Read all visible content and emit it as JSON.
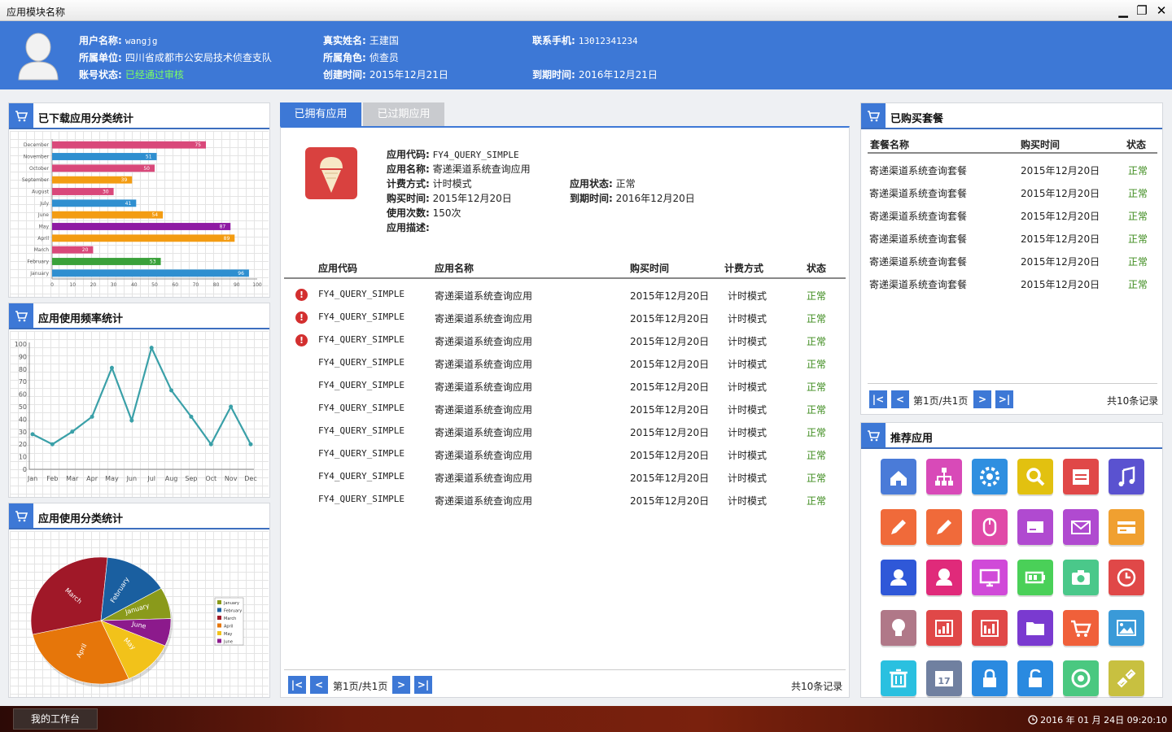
{
  "window": {
    "title": "应用模块名称",
    "min": "▁",
    "restore": "❐",
    "close": "✕"
  },
  "user": {
    "username_label": "用户名称:",
    "username": "wangjg",
    "unit_label": "所属单位:",
    "unit": "四川省成都市公安局技术侦查支队",
    "status_label": "账号状态:",
    "status": "已经通过审核",
    "realname_label": "真实姓名:",
    "realname": "王建国",
    "role_label": "所属角色:",
    "role": "侦查员",
    "created_label": "创建时间:",
    "created": "2015年12月21日",
    "phone_label": "联系手机:",
    "phone": "13012341234",
    "expire_label": "到期时间:",
    "expire": "2016年12月21日"
  },
  "panels": {
    "download_stats": "已下载应用分类统计",
    "freq_stats": "应用使用频率统计",
    "category_stats": "应用使用分类统计",
    "purchased": "已购买套餐",
    "recommended": "推荐应用"
  },
  "chart_data": [
    {
      "type": "bar",
      "categories": [
        "December",
        "November",
        "October",
        "September",
        "August",
        "July",
        "June",
        "May",
        "April",
        "March",
        "February",
        "January"
      ],
      "values": [
        75,
        51,
        50,
        39,
        30,
        41,
        54,
        87,
        89,
        20,
        53,
        96
      ],
      "colors": [
        "#d9487a",
        "#2f8fd0",
        "#d9487a",
        "#f39c12",
        "#d9487a",
        "#2f8fd0",
        "#f39c12",
        "#8e1aa3",
        "#f39c12",
        "#d9487a",
        "#3aa13a",
        "#2f8fd0"
      ],
      "xlim": [
        0,
        100
      ],
      "xticks": [
        0,
        10,
        20,
        30,
        40,
        50,
        60,
        70,
        80,
        90,
        100
      ]
    },
    {
      "type": "line",
      "categories": [
        "Jan",
        "Feb",
        "Mar",
        "Apr",
        "May",
        "Jun",
        "Jul",
        "Aug",
        "Sep",
        "Oct",
        "Nov",
        "Dec"
      ],
      "values": [
        28,
        20,
        30,
        42,
        81,
        39,
        97,
        63,
        42,
        20,
        50,
        20
      ],
      "ylim": [
        0,
        100
      ],
      "yticks": [
        0,
        10,
        20,
        30,
        40,
        50,
        60,
        70,
        80,
        90,
        100
      ],
      "color": "#3aa0a8"
    },
    {
      "type": "pie",
      "labels": [
        "January",
        "February",
        "March",
        "April",
        "May",
        "June"
      ],
      "values": [
        8,
        15,
        30,
        28,
        12,
        7
      ],
      "colors": [
        "#8a9a1b",
        "#1a5fa0",
        "#a01828",
        "#e6760a",
        "#f2c21a",
        "#8c1a8c"
      ]
    }
  ],
  "tabs": {
    "owned": "已拥有应用",
    "expired": "已过期应用"
  },
  "app_detail": {
    "code_label": "应用代码:",
    "code": "FY4_QUERY_SIMPLE",
    "name_label": "应用名称:",
    "name": "寄递渠道系统查询应用",
    "billing_label": "计费方式:",
    "billing": "计时模式",
    "state_label": "应用状态:",
    "state": "正常",
    "buy_label": "购买时间:",
    "buy": "2015年12月20日",
    "due_label": "到期时间:",
    "due": "2016年12月20日",
    "count_label": "使用次数:",
    "count": "150次",
    "desc_label": "应用描述:",
    "desc": ""
  },
  "table": {
    "headers": [
      "应用代码",
      "应用名称",
      "购买时间",
      "计费方式",
      "状态"
    ],
    "rows": [
      {
        "warn": "!",
        "code": "FY4_QUERY_SIMPLE",
        "name": "寄递渠道系统查询应用",
        "date": "2015年12月20日",
        "billing": "计时模式",
        "status": "正常"
      },
      {
        "warn": "!",
        "code": "FY4_QUERY_SIMPLE",
        "name": "寄递渠道系统查询应用",
        "date": "2015年12月20日",
        "billing": "计时模式",
        "status": "正常"
      },
      {
        "warn": "!",
        "code": "FY4_QUERY_SIMPLE",
        "name": "寄递渠道系统查询应用",
        "date": "2015年12月20日",
        "billing": "计时模式",
        "status": "正常"
      },
      {
        "warn": "",
        "code": "FY4_QUERY_SIMPLE",
        "name": "寄递渠道系统查询应用",
        "date": "2015年12月20日",
        "billing": "计时模式",
        "status": "正常"
      },
      {
        "warn": "",
        "code": "FY4_QUERY_SIMPLE",
        "name": "寄递渠道系统查询应用",
        "date": "2015年12月20日",
        "billing": "计时模式",
        "status": "正常"
      },
      {
        "warn": "",
        "code": "FY4_QUERY_SIMPLE",
        "name": "寄递渠道系统查询应用",
        "date": "2015年12月20日",
        "billing": "计时模式",
        "status": "正常"
      },
      {
        "warn": "",
        "code": "FY4_QUERY_SIMPLE",
        "name": "寄递渠道系统查询应用",
        "date": "2015年12月20日",
        "billing": "计时模式",
        "status": "正常"
      },
      {
        "warn": "",
        "code": "FY4_QUERY_SIMPLE",
        "name": "寄递渠道系统查询应用",
        "date": "2015年12月20日",
        "billing": "计时模式",
        "status": "正常"
      },
      {
        "warn": "",
        "code": "FY4_QUERY_SIMPLE",
        "name": "寄递渠道系统查询应用",
        "date": "2015年12月20日",
        "billing": "计时模式",
        "status": "正常"
      },
      {
        "warn": "",
        "code": "FY4_QUERY_SIMPLE",
        "name": "寄递渠道系统查询应用",
        "date": "2015年12月20日",
        "billing": "计时模式",
        "status": "正常"
      }
    ]
  },
  "pager": {
    "first": "|<",
    "prev": "<",
    "next": ">",
    "last": ">|",
    "page": "第1页/共1页",
    "total": "共10条记录"
  },
  "packages": {
    "headers": [
      "套餐名称",
      "购买时间",
      "状态"
    ],
    "rows": [
      {
        "name": "寄递渠道系统查询套餐",
        "date": "2015年12月20日",
        "status": "正常"
      },
      {
        "name": "寄递渠道系统查询套餐",
        "date": "2015年12月20日",
        "status": "正常"
      },
      {
        "name": "寄递渠道系统查询套餐",
        "date": "2015年12月20日",
        "status": "正常"
      },
      {
        "name": "寄递渠道系统查询套餐",
        "date": "2015年12月20日",
        "status": "正常"
      },
      {
        "name": "寄递渠道系统查询套餐",
        "date": "2015年12月20日",
        "status": "正常"
      },
      {
        "name": "寄递渠道系统查询套餐",
        "date": "2015年12月20日",
        "status": "正常"
      }
    ]
  },
  "tiles": [
    {
      "icon": "home-icon",
      "color": "#4a7bd8"
    },
    {
      "icon": "sitemap-icon",
      "color": "#d84ab8"
    },
    {
      "icon": "settings-icon",
      "color": "#2f8fe0"
    },
    {
      "icon": "search-icon",
      "color": "#e2c110"
    },
    {
      "icon": "calendar-icon",
      "color": "#e04848"
    },
    {
      "icon": "music-icon",
      "color": "#5a52d0"
    },
    {
      "icon": "pencil-icon",
      "color": "#f06a3a"
    },
    {
      "icon": "edit-icon",
      "color": "#f06a3a"
    },
    {
      "icon": "mouse-icon",
      "color": "#e04aa8"
    },
    {
      "icon": "card-icon",
      "color": "#b04ad0"
    },
    {
      "icon": "mail-icon",
      "color": "#b04ad0"
    },
    {
      "icon": "wallet-icon",
      "color": "#f0a030"
    },
    {
      "icon": "user-icon",
      "color": "#2f58d8"
    },
    {
      "icon": "user-female-icon",
      "color": "#e02a7a"
    },
    {
      "icon": "monitor-icon",
      "color": "#d04ad8"
    },
    {
      "icon": "battery-icon",
      "color": "#4ad058"
    },
    {
      "icon": "camera-icon",
      "color": "#4ac88a"
    },
    {
      "icon": "clock-icon",
      "color": "#e04848"
    },
    {
      "icon": "bulb-icon",
      "color": "#b07888"
    },
    {
      "icon": "chart-icon",
      "color": "#e04848"
    },
    {
      "icon": "bar-chart-icon",
      "color": "#e04848"
    },
    {
      "icon": "folder-icon",
      "color": "#7a3ad0"
    },
    {
      "icon": "cart-icon",
      "color": "#f0603a"
    },
    {
      "icon": "image-icon",
      "color": "#3a9ad8"
    },
    {
      "icon": "trash-icon",
      "color": "#2ac0e0"
    },
    {
      "icon": "calendar-17-icon",
      "color": "#7080a0"
    },
    {
      "icon": "lock-icon",
      "color": "#2a8ae0"
    },
    {
      "icon": "unlock-icon",
      "color": "#2a8ae0"
    },
    {
      "icon": "chrome-icon",
      "color": "#4ac880"
    },
    {
      "icon": "link-icon",
      "color": "#c8c040"
    }
  ],
  "taskbar": {
    "start": "我的工作台",
    "clock": "2016 年 01 月 24日 09:20:10"
  }
}
